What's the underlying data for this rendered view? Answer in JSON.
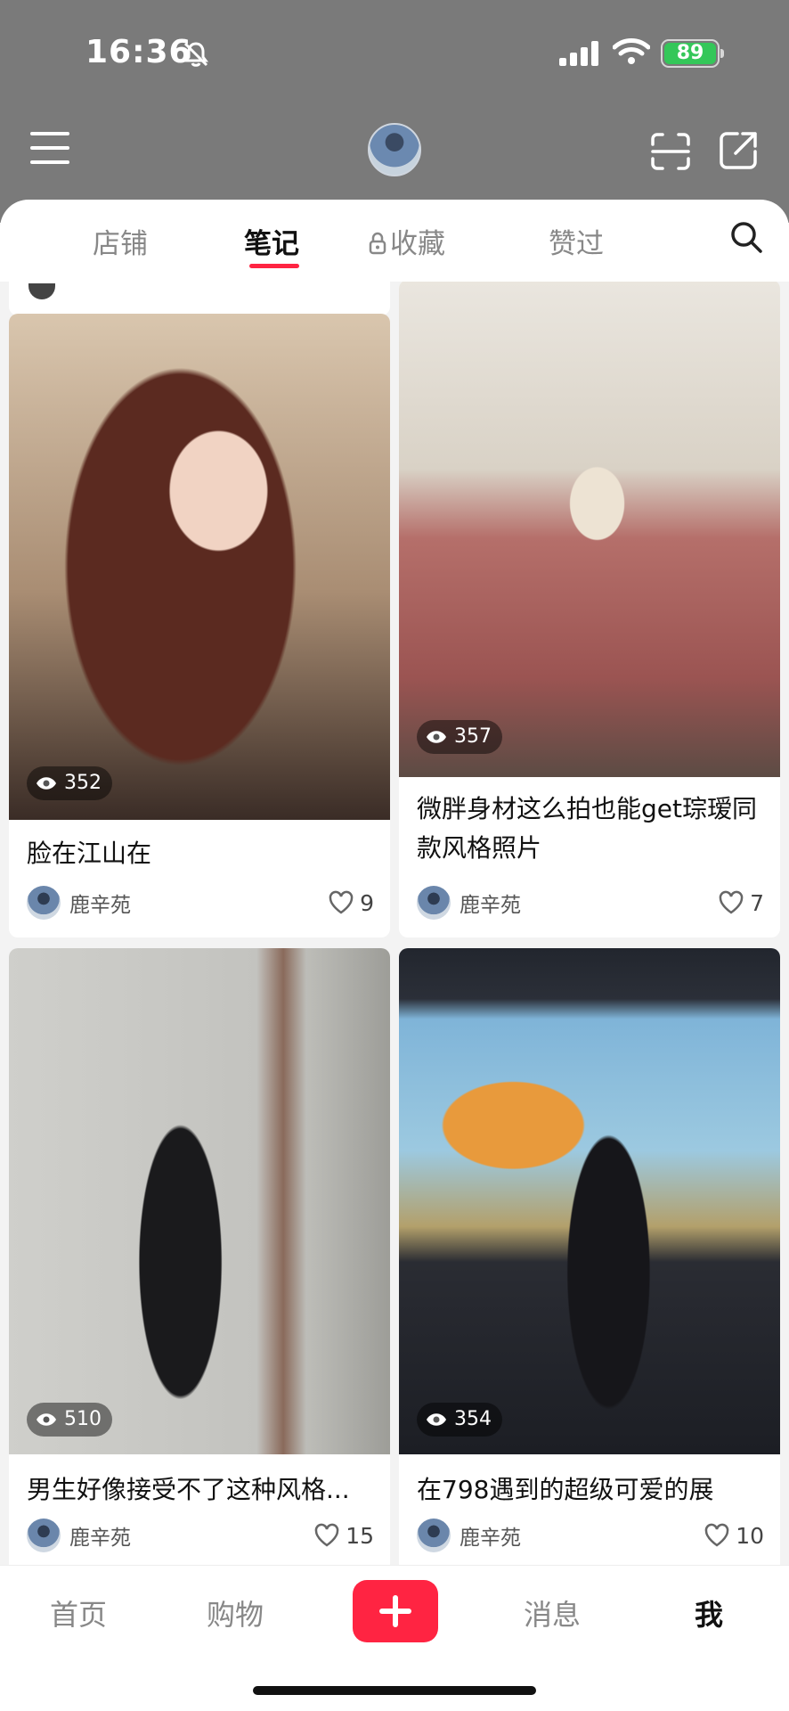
{
  "status_bar": {
    "time": "16:36",
    "battery": "89"
  },
  "profile_header": {
    "icons": [
      "menu-icon",
      "avatar",
      "scan-icon",
      "share-icon"
    ]
  },
  "tabs": [
    {
      "label": "店铺",
      "active": false
    },
    {
      "label": "笔记",
      "active": true
    },
    {
      "label": "收藏",
      "active": false,
      "locked": true
    },
    {
      "label": "赞过",
      "active": false
    }
  ],
  "notes": [
    {
      "title": "脸在江山在",
      "views": "352",
      "author": "鹿辛苑",
      "likes": "9"
    },
    {
      "title": "微胖身材这么拍也能get琮瑷同款风格照片",
      "views": "357",
      "author": "鹿辛苑",
      "likes": "7"
    },
    {
      "title": "男生好像接受不了这种风格...",
      "views": "510",
      "author": "鹿辛苑",
      "likes": "15"
    },
    {
      "title": "在798遇到的超级可爱的展",
      "views": "354",
      "author": "鹿辛苑",
      "likes": "10"
    }
  ],
  "bottom_nav": {
    "home": "首页",
    "shop": "购物",
    "messages": "消息",
    "me": "我"
  },
  "colors": {
    "accent": "#ff2442",
    "header_bg": "#7a7a7a"
  }
}
